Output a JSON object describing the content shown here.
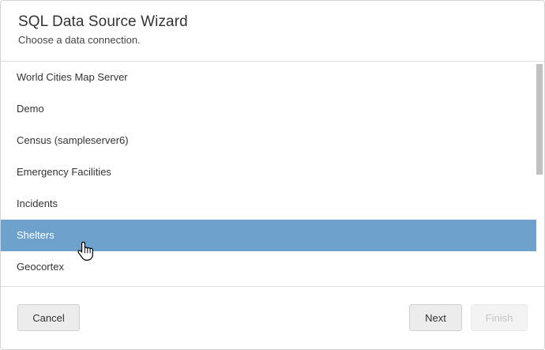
{
  "dialog": {
    "title": "SQL Data Source Wizard",
    "subtitle": "Choose a data connection."
  },
  "connections": {
    "items": [
      {
        "label": "World Cities Map Server",
        "selected": false
      },
      {
        "label": "Demo",
        "selected": false
      },
      {
        "label": "Census (sampleserver6)",
        "selected": false
      },
      {
        "label": "Emergency Facilities",
        "selected": false
      },
      {
        "label": "Incidents",
        "selected": false
      },
      {
        "label": "Shelters",
        "selected": true
      },
      {
        "label": "Geocortex",
        "selected": false
      }
    ],
    "selected_color": "#6fa1cd"
  },
  "footer": {
    "cancel_label": "Cancel",
    "next_label": "Next",
    "finish_label": "Finish",
    "finish_disabled": true
  },
  "cursor": {
    "icon": "hand-pointer-icon"
  }
}
